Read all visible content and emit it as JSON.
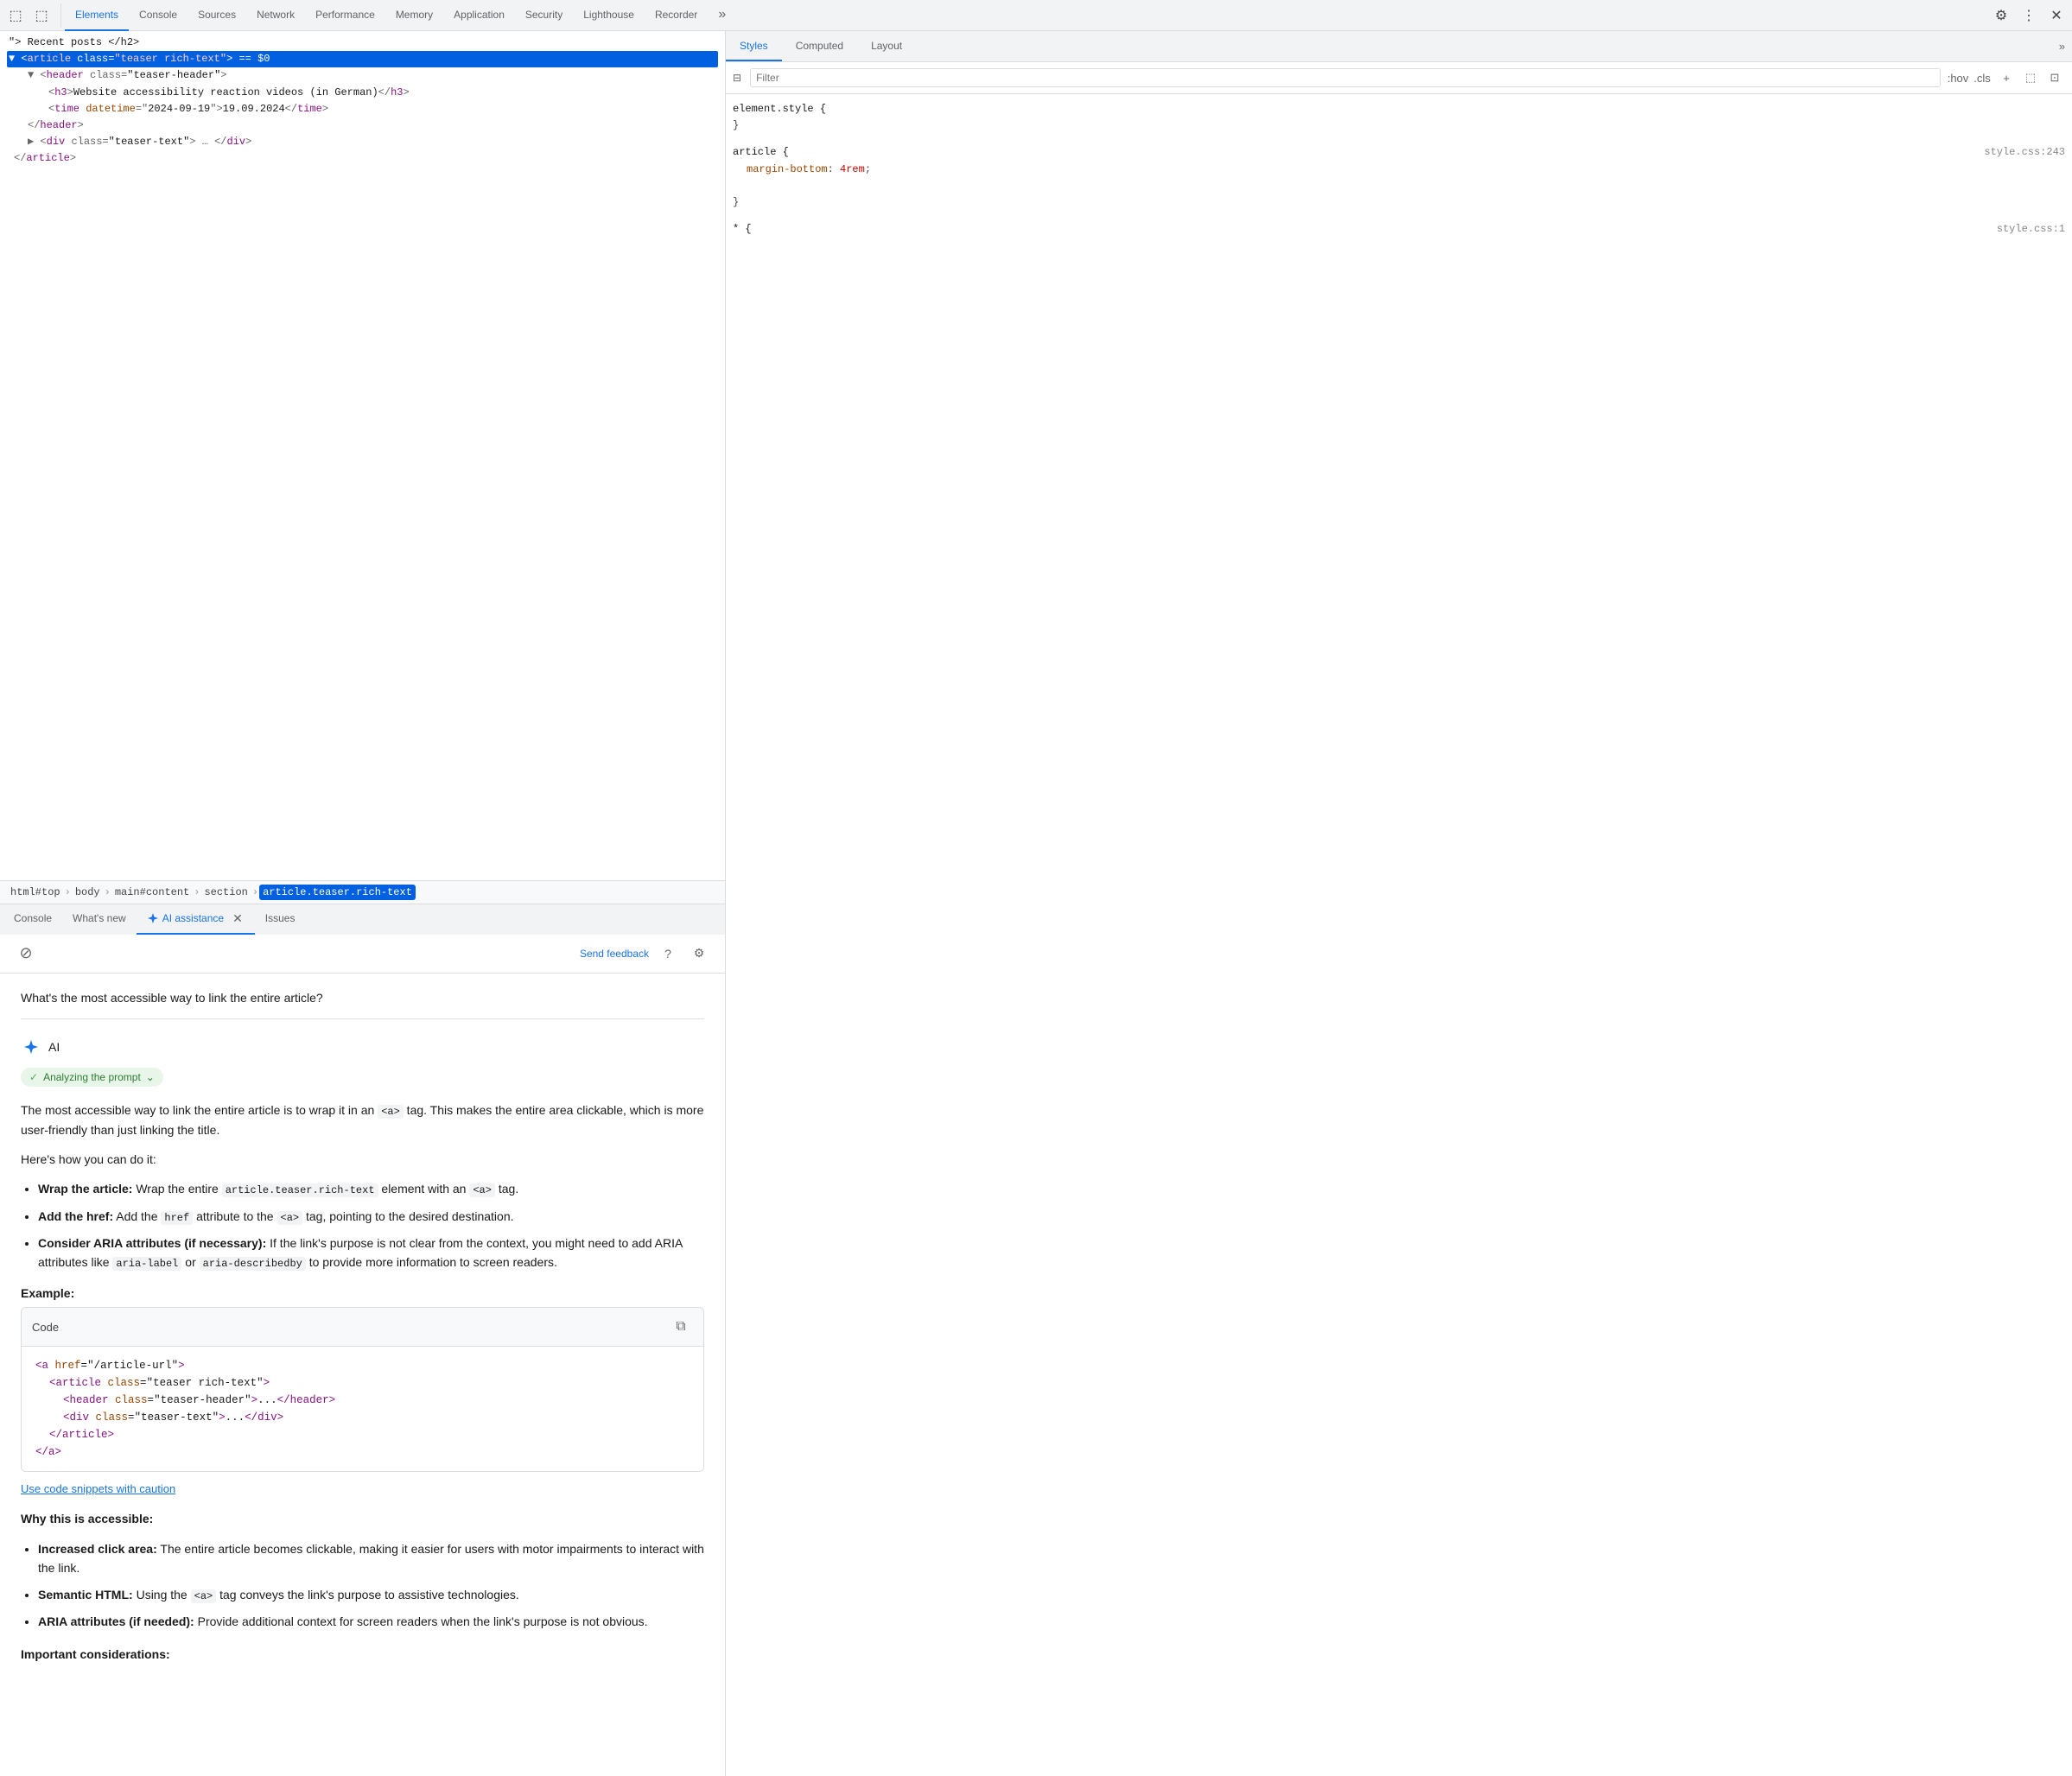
{
  "topBar": {
    "icons": [
      "☰",
      "⬚"
    ],
    "tabs": [
      {
        "label": "Elements",
        "active": true
      },
      {
        "label": "Console",
        "active": false
      },
      {
        "label": "Sources",
        "active": false
      },
      {
        "label": "Network",
        "active": false
      },
      {
        "label": "Performance",
        "active": false
      },
      {
        "label": "Memory",
        "active": false
      },
      {
        "label": "Application",
        "active": false
      },
      {
        "label": "Security",
        "active": false
      },
      {
        "label": "Lighthouse",
        "active": false
      },
      {
        "label": "Recorder",
        "active": false
      }
    ],
    "moreLabel": "»",
    "settingsLabel": "⚙",
    "menuLabel": "⋮",
    "undockLabel": "⊡"
  },
  "htmlTree": {
    "lines": [
      {
        "text": "\"> Recent posts </h2>",
        "indent": 0,
        "selected": false
      },
      {
        "text": "<article class=\"teaser rich-text\"> == $0",
        "indent": 1,
        "selected": false,
        "isSelected": true
      },
      {
        "text": "<header class=\"teaser-header\">",
        "indent": 2,
        "selected": false
      },
      {
        "text": "<h3>Website accessibility reaction videos (in German)</h3>",
        "indent": 3,
        "selected": false
      },
      {
        "text": "<time datetime=\"2024-09-19\">19.09.2024</time>",
        "indent": 3,
        "selected": false
      },
      {
        "text": "</header>",
        "indent": 2,
        "selected": false
      },
      {
        "text": "<div class=\"teaser-text\"> … </div>",
        "indent": 2,
        "selected": false
      },
      {
        "text": "</article>",
        "indent": 1,
        "selected": false
      }
    ]
  },
  "breadcrumb": {
    "items": [
      {
        "label": "html#top",
        "active": false
      },
      {
        "label": "body",
        "active": false
      },
      {
        "label": "main#content",
        "active": false
      },
      {
        "label": "section",
        "active": false
      },
      {
        "label": "article.teaser.rich-text",
        "active": true
      }
    ]
  },
  "bottomTabs": [
    {
      "label": "Console",
      "active": false
    },
    {
      "label": "What's new",
      "active": false
    },
    {
      "label": "AI assistance",
      "active": true,
      "hasClose": true
    },
    {
      "label": "Issues",
      "active": false
    }
  ],
  "aiPanel": {
    "cancelLabel": "⊘",
    "sendFeedbackLabel": "Send feedback",
    "helpLabel": "?",
    "settingsLabel": "⚙",
    "userQuestion": "What's the most accessible way to link the entire article?",
    "aiLabel": "AI",
    "analyzingLabel": "Analyzing the prompt",
    "chevronLabel": "⌄",
    "introText": "The most accessible way to link the entire article is to wrap it in an",
    "introCode1": "<a>",
    "introText2": "tag. This makes the entire area clickable, which is more user-friendly than just linking the title.",
    "howToLabel": "Here's how you can do it:",
    "bullets": [
      {
        "bold": "Wrap the article:",
        "text": " Wrap the entire ",
        "code1": "article.teaser.rich-text",
        "text2": " element with an ",
        "code2": "<a>",
        "text3": " tag."
      },
      {
        "bold": "Add the href:",
        "text": " Add the ",
        "code1": "href",
        "text2": " attribute to the ",
        "code2": "<a>",
        "text3": " tag, pointing to the desired destination."
      },
      {
        "bold": "Consider ARIA attributes (if necessary):",
        "text": " If the link's purpose is not clear from the context, you might need to add ARIA attributes like ",
        "code1": "aria-label",
        "text2": " or ",
        "code2": "aria-describedby",
        "text3": " to provide more information to screen readers."
      }
    ],
    "exampleLabel": "Example:",
    "codeBlock": {
      "title": "Code",
      "copyLabel": "⧉",
      "lines": [
        "<a href=\"/article-url\">",
        "    <article class=\"teaser rich-text\">",
        "        <header class=\"teaser-header\">...</header>",
        "        <div class=\"teaser-text\">...</div>",
        "    </article>",
        "</a>"
      ]
    },
    "cautionLabel": "Use code snippets with caution",
    "whyLabel": "Why this is accessible:",
    "whyBullets": [
      {
        "bold": "Increased click area:",
        "text": " The entire article becomes clickable, making it easier for users with motor impairments to interact with the link."
      },
      {
        "bold": "Semantic HTML:",
        "text": " Using the ",
        "code": "<a>",
        "text2": " tag conveys the link's purpose to assistive technologies."
      },
      {
        "bold": "ARIA attributes (if needed):",
        "text": " Provide additional context for screen readers when the link's purpose is not obvious."
      }
    ],
    "importantLabel": "Important considerations:"
  },
  "rightPanel": {
    "tabs": [
      {
        "label": "Styles",
        "active": true
      },
      {
        "label": "Computed",
        "active": false
      },
      {
        "label": "Layout",
        "active": false
      }
    ],
    "moreLabel": "»",
    "filterPlaceholder": "Filter",
    "filterHover": ":hov",
    "filterCls": ".cls",
    "filterPlus": "+",
    "styleRules": [
      {
        "selector": "element.style {",
        "source": "",
        "properties": [],
        "close": "}"
      },
      {
        "selector": "article {",
        "source": "style.css:243",
        "properties": [
          {
            "prop": "margin-bottom",
            "val": "4rem",
            "isRed": true
          }
        ],
        "close": "}"
      },
      {
        "selector": "* {",
        "source": "style.css:1",
        "properties": [],
        "close": ""
      }
    ]
  }
}
